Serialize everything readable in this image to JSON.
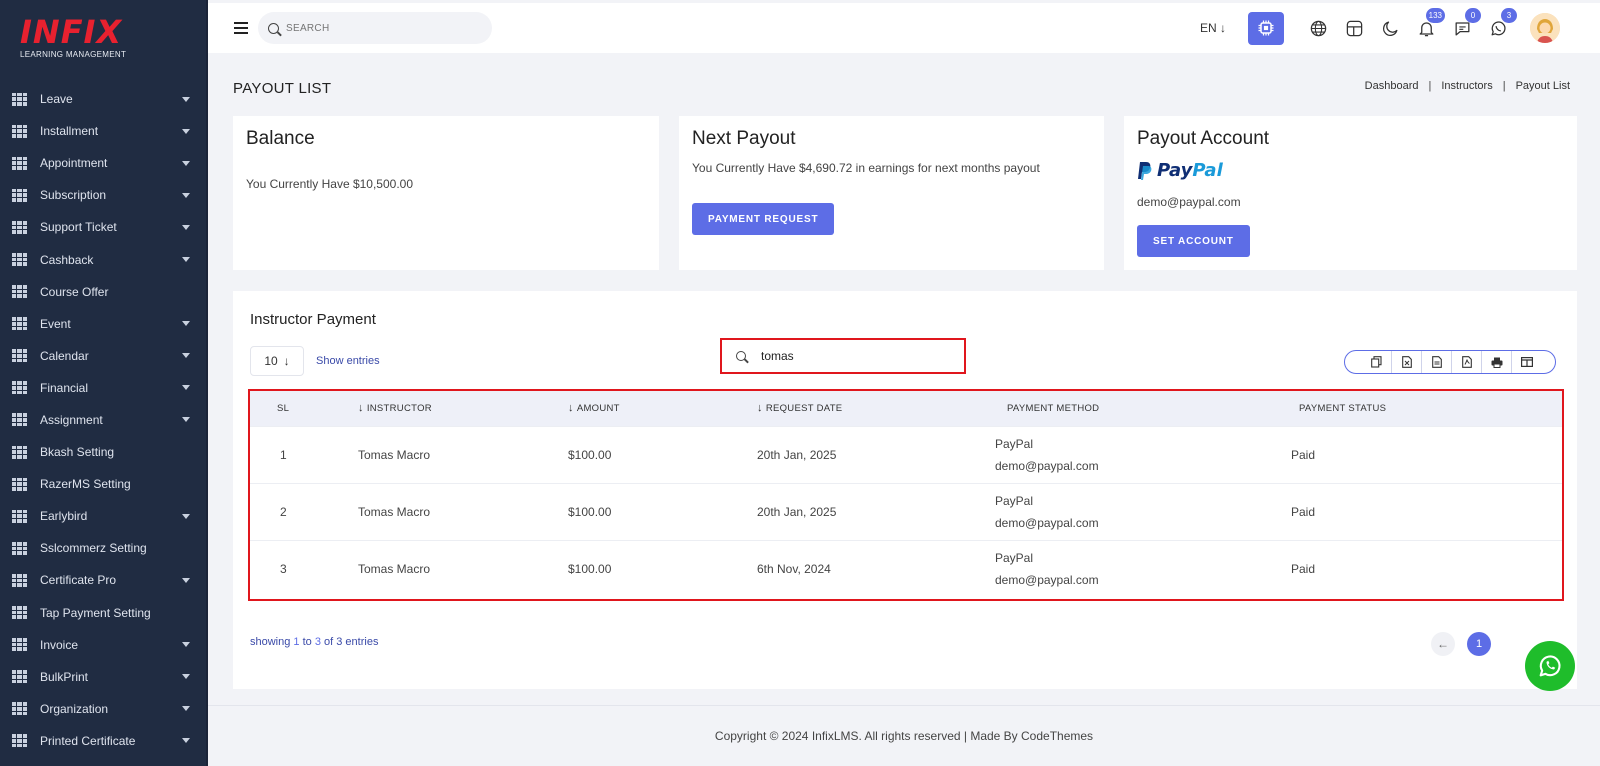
{
  "brand": {
    "name": "INFIX",
    "tagline": "LEARNING MANAGEMENT",
    "color": "#e8212f"
  },
  "sidebar": {
    "items": [
      {
        "label": "Leave",
        "caret": true
      },
      {
        "label": "Installment",
        "caret": true
      },
      {
        "label": "Appointment",
        "caret": true
      },
      {
        "label": "Subscription",
        "caret": true
      },
      {
        "label": "Support Ticket",
        "caret": true
      },
      {
        "label": "Cashback",
        "caret": true
      },
      {
        "label": "Course Offer",
        "caret": false
      },
      {
        "label": "Event",
        "caret": true
      },
      {
        "label": "Calendar",
        "caret": true
      },
      {
        "label": "Financial",
        "caret": true
      },
      {
        "label": "Assignment",
        "caret": true
      },
      {
        "label": "Bkash Setting",
        "caret": false
      },
      {
        "label": "RazerMS Setting",
        "caret": false
      },
      {
        "label": "Earlybird",
        "caret": true
      },
      {
        "label": "Sslcommerz Setting",
        "caret": false
      },
      {
        "label": "Certificate Pro",
        "caret": true
      },
      {
        "label": "Tap Payment Setting",
        "caret": false
      },
      {
        "label": "Invoice",
        "caret": true
      },
      {
        "label": "BulkPrint",
        "caret": true
      },
      {
        "label": "Organization",
        "caret": true
      },
      {
        "label": "Printed Certificate",
        "caret": true
      }
    ]
  },
  "topbar": {
    "search_placeholder": "SEARCH",
    "language": "EN",
    "notifications_count": "133",
    "messages_count": "0",
    "whatsapp_count": "3"
  },
  "page": {
    "title": "PAYOUT LIST",
    "breadcrumbs": [
      "Dashboard",
      "Instructors",
      "Payout List"
    ]
  },
  "cards": {
    "balance": {
      "title": "Balance",
      "text": "You Currently Have $10,500.00"
    },
    "next_payout": {
      "title": "Next Payout",
      "text": "You Currently Have $4,690.72 in earnings for next months payout",
      "button": "PAYMENT REQUEST"
    },
    "payout_account": {
      "title": "Payout Account",
      "logo_a": "Pay",
      "logo_b": "Pal",
      "email": "demo@paypal.com",
      "button": "SET ACCOUNT"
    }
  },
  "table_section": {
    "title": "Instructor Payment",
    "entries_value": "10",
    "entries_label": "Show entries",
    "search_value": "tomas",
    "columns": [
      "SL",
      "INSTRUCTOR",
      "AMOUNT",
      "REQUEST DATE",
      "PAYMENT METHOD",
      "PAYMENT STATUS"
    ],
    "rows": [
      {
        "sl": "1",
        "instructor": "Tomas Macro",
        "amount": "$100.00",
        "date": "20th Jan, 2025",
        "method": "PayPal",
        "method_email": "demo@paypal.com",
        "status": "Paid"
      },
      {
        "sl": "2",
        "instructor": "Tomas Macro",
        "amount": "$100.00",
        "date": "20th Jan, 2025",
        "method": "PayPal",
        "method_email": "demo@paypal.com",
        "status": "Paid"
      },
      {
        "sl": "3",
        "instructor": "Tomas Macro",
        "amount": "$100.00",
        "date": "6th Nov, 2024",
        "method": "PayPal",
        "method_email": "demo@paypal.com",
        "status": "Paid"
      }
    ],
    "showing_prefix": "showing ",
    "showing_from": "1",
    "showing_to_word": " to ",
    "showing_to": "3",
    "showing_of": " of 3 entries",
    "current_page": "1"
  },
  "footer": {
    "text": "Copyright © 2024 InfixLMS. All rights reserved | Made By CodeThemes"
  },
  "colors": {
    "accent": "#5d6de6",
    "sidebar_bg": "#202c42",
    "highlight_border": "#e0161d",
    "whatsapp": "#1fbd2b"
  }
}
